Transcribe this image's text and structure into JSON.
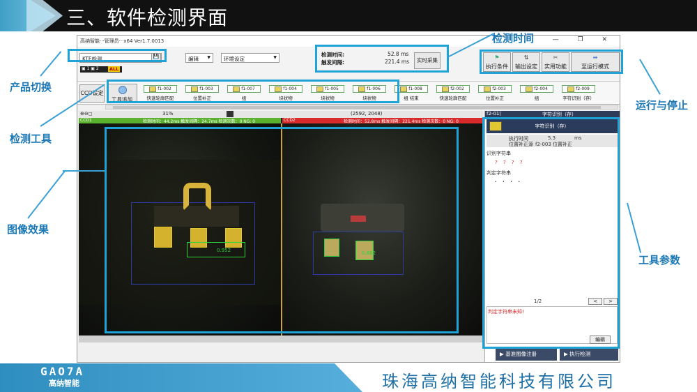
{
  "slide": {
    "title": "三、软件检测界面",
    "footer_logo": "GAO7A",
    "footer_logo_cn": "高纳智能",
    "company": "珠海高纳智能科技有限公司"
  },
  "annotations": {
    "product_switch": "产品切换",
    "detect_tools": "检测工具",
    "image_effect": "图像效果",
    "detect_time": "检测时间",
    "run_stop": "运行与停止",
    "tool_params": "工具参数"
  },
  "window": {
    "title": "高纳智能···管理员···x64 Ver1.7.0013",
    "controls": "— ❐ ✕"
  },
  "toolbar": {
    "product_select": "KTE检测",
    "edit_menu": "编辑",
    "env_menu": "环境设定",
    "detect_time_label": "检测时间:",
    "detect_time_value": "52.8 ms",
    "trigger_interval_label": "触发间隔:",
    "trigger_interval_value": "221.4 ms",
    "realtime_capture": "实时采集",
    "all_badge": "ALL",
    "exec_condition": "执行条件",
    "output_setting": "输出设定",
    "utility": "实用功能",
    "to_run_mode": "至运行模式"
  },
  "tools": {
    "ccd_setting": "CCD设定",
    "add_tool": "工具追加",
    "items": [
      {
        "id": "f1-002",
        "name": "快速轮廓匹配"
      },
      {
        "id": "f1-003",
        "name": "位置补正"
      },
      {
        "id": "f1-007",
        "name": "组"
      },
      {
        "id": "f1-004",
        "name": "块状物"
      },
      {
        "id": "f1-005",
        "name": "块状物"
      },
      {
        "id": "f1-006",
        "name": "块状物"
      },
      {
        "id": "f1-008",
        "name": "组 结束"
      },
      {
        "id": "f2-002",
        "name": "快速轮廓匹配"
      },
      {
        "id": "f2-003",
        "name": "位置补正"
      },
      {
        "id": "f2-004",
        "name": "组"
      },
      {
        "id": "f2-009",
        "name": "字符识别（存）"
      }
    ]
  },
  "image": {
    "zoom": "31%",
    "coords": "(2592, 2048)",
    "ccd1": {
      "name": "CCD1",
      "time": "检测时间：44.2ms  触发间隔：24.7ms  检测次数：0  NG: 0"
    },
    "ccd2": {
      "name": "CCD2",
      "time": "检测时间：52.8ms  触发间隔：221.4ms  检测次数：0  NG: 0"
    },
    "score1": "0.952",
    "score2": "0.862"
  },
  "params": {
    "header_id": "f2-01(",
    "header_name": "字符识别（存）",
    "tool_name": "字符识别（存）",
    "exec_time_label": "执行时间",
    "exec_time_value": "5.3",
    "exec_time_unit": "ms",
    "pos_source_label": "位置补正源",
    "pos_source_value": "f2-003 位置补正",
    "recog_label": "识别字符串",
    "recog_value": "? ? ? ?",
    "judge_label": "判定字符串",
    "judge_value": "· · · ·",
    "page": "1/2",
    "prev": "<",
    "next": ">",
    "error_msg": "判定字符串未知!",
    "edit": "编辑",
    "base_register": "基准图像注册",
    "exec_detect": "执行检测"
  }
}
